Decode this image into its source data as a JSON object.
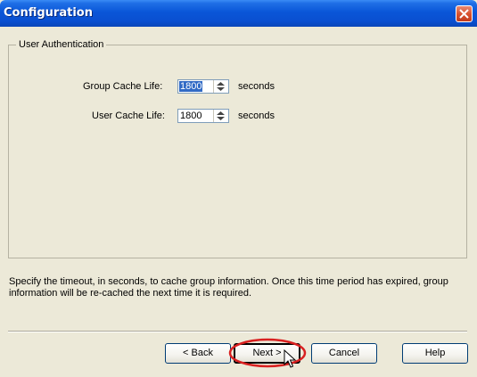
{
  "window": {
    "title": "Configuration",
    "close_icon": "close-icon"
  },
  "group": {
    "legend": "User Authentication",
    "fields": [
      {
        "label": "Group Cache Life:",
        "value": "1800",
        "unit": "seconds"
      },
      {
        "label": "User Cache Life:",
        "value": "1800",
        "unit": "seconds"
      }
    ]
  },
  "help_text": "Specify the timeout, in seconds, to cache group information. Once this time period has expired, group information will be re-cached the next time it is required.",
  "buttons": {
    "back": "< Back",
    "next": "Next >",
    "cancel": "Cancel",
    "help": "Help"
  },
  "annotation": {
    "highlight_color": "#d92020",
    "target": "Next >"
  },
  "colors": {
    "titlebar": "#0a56d8",
    "dialog_bg": "#ece9d8",
    "selection": "#316ac5"
  }
}
